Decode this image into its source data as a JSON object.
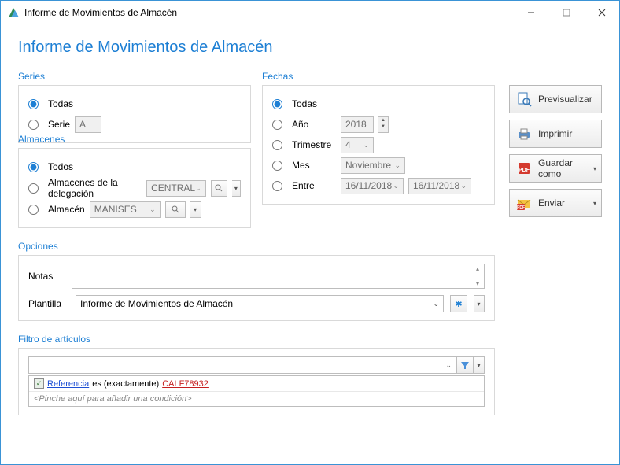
{
  "window": {
    "title": "Informe de Movimientos de Almacén"
  },
  "header": {
    "title": "Informe de Movimientos de Almacén"
  },
  "series": {
    "legend": "Series",
    "todas": "Todas",
    "serie": "Serie",
    "serie_value": "A"
  },
  "almacenes": {
    "legend": "Almacenes",
    "todos": "Todos",
    "delegacion": "Almacenes de la delegación",
    "delegacion_value": "CENTRAL",
    "almacen": "Almacén",
    "almacen_value": "MANISES"
  },
  "fechas": {
    "legend": "Fechas",
    "todas": "Todas",
    "ano": "Año",
    "ano_value": "2018",
    "trimestre": "Trimestre",
    "trimestre_value": "4",
    "mes": "Mes",
    "mes_value": "Noviembre",
    "entre": "Entre",
    "entre_from": "16/11/2018",
    "entre_to": "16/11/2018"
  },
  "opciones": {
    "legend": "Opciones",
    "notas": "Notas",
    "plantilla": "Plantilla",
    "plantilla_value": "Informe de Movimientos de Almacén"
  },
  "filtro": {
    "legend": "Filtro de artículos",
    "field": "Referencia",
    "op": "es (exactamente)",
    "value": "CALF78932",
    "add_hint": "<Pinche aquí para añadir una condición>"
  },
  "buttons": {
    "previsualizar": "Previsualizar",
    "imprimir": "Imprimir",
    "guardar": "Guardar como",
    "enviar": "Enviar"
  }
}
